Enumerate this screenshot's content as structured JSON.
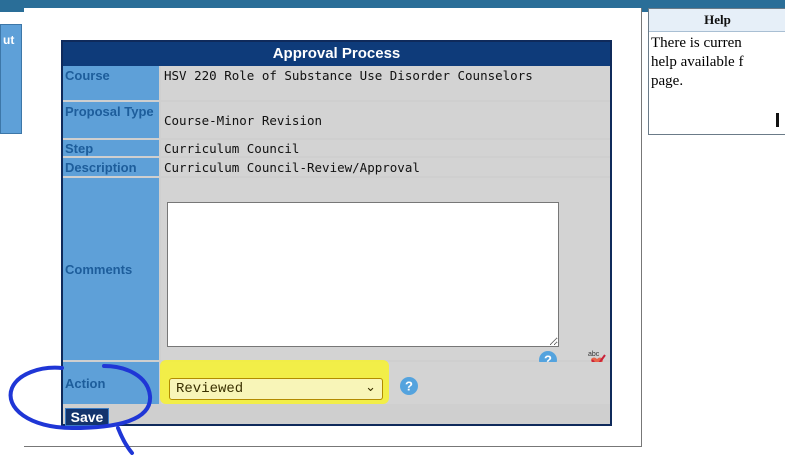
{
  "sidebar": {
    "tab_label": "ut"
  },
  "approval": {
    "title": "Approval Process",
    "fields": [
      {
        "label": "Course",
        "value": "HSV 220 Role of Substance Use Disorder Counselors"
      },
      {
        "label": "Proposal Type",
        "value": "Course-Minor Revision"
      },
      {
        "label": "Step",
        "value": "Curriculum Council"
      },
      {
        "label": "Description",
        "value": "Curriculum Council-Review/Approval"
      }
    ],
    "comments_label": "Comments",
    "comments_value": "",
    "action_label": "Action",
    "action_value": "Reviewed",
    "save_label": "Save"
  },
  "help": {
    "title": "Help",
    "text": "There is curren\nhelp available f\npage."
  },
  "colors": {
    "header_bg": "#0e3b7a",
    "label_bg": "#5ea0d8",
    "highlight": "#f7f22f",
    "scribble": "#1f36d6"
  },
  "icons": [
    "help-icon",
    "spell-check-icon",
    "dropdown-caret-icon"
  ]
}
